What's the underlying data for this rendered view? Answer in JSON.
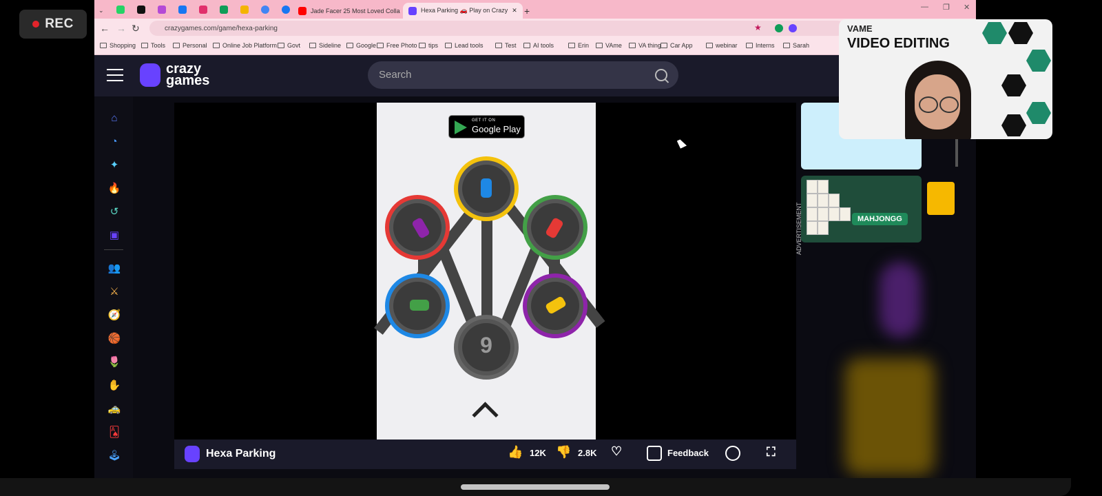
{
  "overlay": {
    "rec_label": "REC"
  },
  "tabs": [
    {
      "label": "Jade Facer 25 Most Loved Colla",
      "active": false
    },
    {
      "label": "Hexa Parking 🚗 Play on Crazy",
      "active": true
    }
  ],
  "address": {
    "url": "crazygames.com/game/hexa-parking"
  },
  "bookmarks": [
    "Shopping",
    "Tools",
    "Personal",
    "Online Job Platform",
    "Govt",
    "Sideline",
    "Google",
    "Free Photo",
    "tips",
    "Lead tools",
    "Test",
    "AI tools",
    "Erin",
    "VAme",
    "VA thing",
    "Car App",
    "webinar",
    "Interns",
    "Sarah"
  ],
  "site": {
    "logo_line1": "crazy",
    "logo_line2": "games",
    "search_placeholder": "Search"
  },
  "game": {
    "store_small": "GET IT ON",
    "store_big": "Google Play",
    "level": "9",
    "title": "Hexa Parking",
    "likes": "12K",
    "dislikes": "2.8K",
    "feedback": "Feedback"
  },
  "right": {
    "mahjong_label": "MAHJONGG",
    "ad_label": "ADVERTISEMENT"
  },
  "webcam": {
    "brand": "VAME",
    "title": "VIDEO EDITING"
  },
  "colors": {
    "brand_purple": "#6842ff",
    "header_bg": "#1a1a2a",
    "tabbar_pink": "#f7b8c9",
    "ring_yellow": "#f4c20d",
    "ring_red": "#e53935",
    "ring_green": "#43a047",
    "ring_blue": "#1e88e5",
    "ring_purple": "#8e24aa"
  }
}
